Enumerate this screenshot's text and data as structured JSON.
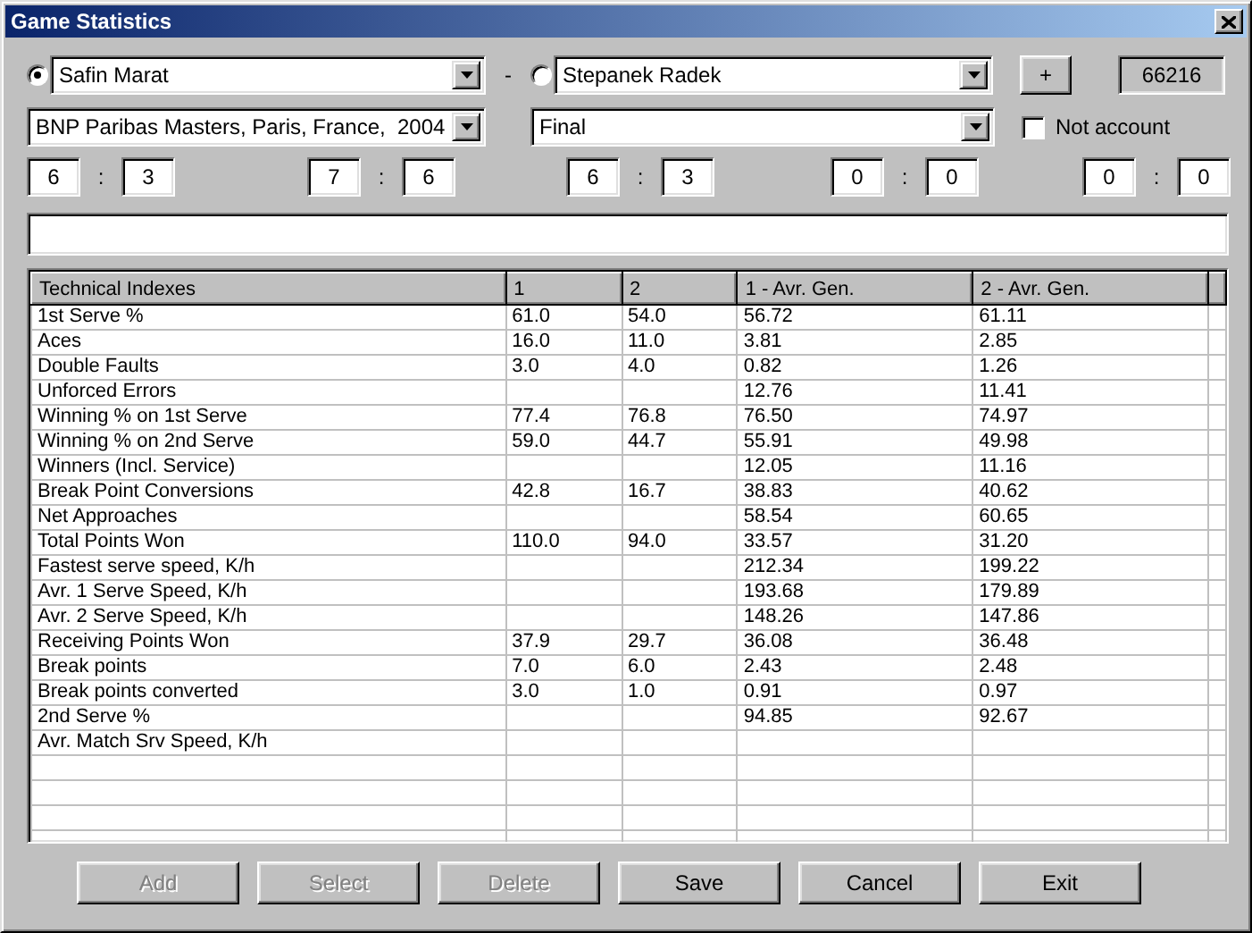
{
  "window": {
    "title": "Game Statistics"
  },
  "players": [
    {
      "name": "Safin Marat",
      "selected": true
    },
    {
      "name": "Stepanek Radek",
      "selected": false
    }
  ],
  "versus": "-",
  "add_button": "+",
  "match_id": "66216",
  "tournament": "BNP Paribas Masters, Paris, France,  2004",
  "round": "Final",
  "not_account": {
    "label": "Not account",
    "checked": false
  },
  "sets": [
    {
      "player_1": "6",
      "separator": ":",
      "player_2": "3"
    },
    {
      "player_1": "7",
      "separator": ":",
      "player_2": "6"
    },
    {
      "player_1": "6",
      "separator": ":",
      "player_2": "3"
    },
    {
      "player_1": "0",
      "separator": ":",
      "player_2": "0"
    },
    {
      "player_1": "0",
      "separator": ":",
      "player_2": "0"
    }
  ],
  "table": {
    "columns": [
      "Technical Indexes",
      "1",
      "2",
      "1 - Avr. Gen.",
      "2 - Avr. Gen."
    ],
    "rows": [
      {
        "index": "1st Serve %",
        "player_1": "61.0",
        "player_2": "54.0",
        "avg_1": "56.72",
        "avg_2": "61.11"
      },
      {
        "index": "Aces",
        "player_1": "16.0",
        "player_2": "11.0",
        "avg_1": "3.81",
        "avg_2": "2.85"
      },
      {
        "index": "Double Faults",
        "player_1": "3.0",
        "player_2": "4.0",
        "avg_1": "0.82",
        "avg_2": "1.26"
      },
      {
        "index": "Unforced Errors",
        "avg_1": "12.76",
        "avg_2": "11.41"
      },
      {
        "index": "Winning % on 1st Serve",
        "player_1": "77.4",
        "player_2": "76.8",
        "avg_1": "76.50",
        "avg_2": "74.97"
      },
      {
        "index": "Winning % on 2nd Serve",
        "player_1": "59.0",
        "player_2": "44.7",
        "avg_1": "55.91",
        "avg_2": "49.98"
      },
      {
        "index": "Winners (Incl. Service)",
        "avg_1": "12.05",
        "avg_2": "11.16"
      },
      {
        "index": "Break Point Conversions",
        "player_1": "42.8",
        "player_2": "16.7",
        "avg_1": "38.83",
        "avg_2": "40.62"
      },
      {
        "index": "Net Approaches",
        "avg_1": "58.54",
        "avg_2": "60.65"
      },
      {
        "index": "Total Points Won",
        "player_1": "110.0",
        "player_2": "94.0",
        "avg_1": "33.57",
        "avg_2": "31.20"
      },
      {
        "index": "Fastest serve speed, K/h",
        "avg_1": "212.34",
        "avg_2": "199.22"
      },
      {
        "index": "Avr. 1 Serve Speed, K/h",
        "avg_1": "193.68",
        "avg_2": "179.89"
      },
      {
        "index": "Avr. 2 Serve Speed, K/h",
        "avg_1": "148.26",
        "avg_2": "147.86"
      },
      {
        "index": "Receiving Points Won",
        "player_1": "37.9",
        "player_2": "29.7",
        "avg_1": "36.08",
        "avg_2": "36.48"
      },
      {
        "index": "Break points",
        "player_1": "7.0",
        "player_2": "6.0",
        "avg_1": "2.43",
        "avg_2": "2.48"
      },
      {
        "index": "Break points converted",
        "player_1": "3.0",
        "player_2": "1.0",
        "avg_1": "0.91",
        "avg_2": "0.97"
      },
      {
        "index": "2nd Serve %",
        "avg_1": "94.85",
        "avg_2": "92.67"
      },
      {
        "index": "Avr. Match Srv Speed, K/h"
      }
    ]
  },
  "buttons": [
    {
      "label": "Add",
      "disabled": true
    },
    {
      "label": "Select",
      "disabled": true
    },
    {
      "label": "Delete",
      "disabled": true
    },
    {
      "label": "Save",
      "disabled": false
    },
    {
      "label": "Cancel",
      "disabled": false
    },
    {
      "label": "Exit",
      "disabled": false
    }
  ]
}
